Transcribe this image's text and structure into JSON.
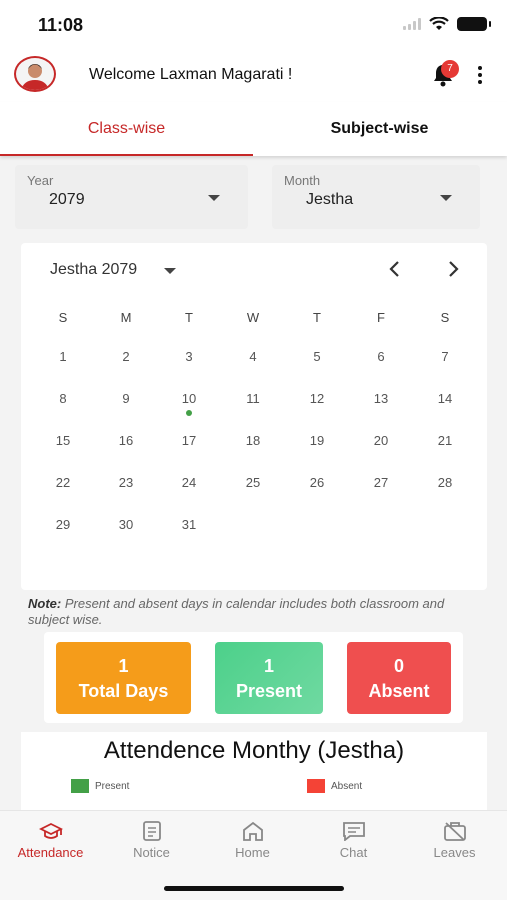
{
  "status_bar": {
    "time": "11:08"
  },
  "header": {
    "welcome_text": "Welcome Laxman Magarati !",
    "notification_count": "7"
  },
  "tabs": [
    {
      "label": "Class-wise",
      "active": true
    },
    {
      "label": "Subject-wise",
      "active": false
    }
  ],
  "filters": {
    "year": {
      "label": "Year",
      "value": "2079"
    },
    "month": {
      "label": "Month",
      "value": "Jestha"
    }
  },
  "calendar": {
    "title": "Jestha 2079",
    "weekdays": [
      "S",
      "M",
      "T",
      "W",
      "T",
      "F",
      "S"
    ],
    "days": [
      "1",
      "2",
      "3",
      "4",
      "5",
      "6",
      "7",
      "8",
      "9",
      "10",
      "11",
      "12",
      "13",
      "14",
      "15",
      "16",
      "17",
      "18",
      "19",
      "20",
      "21",
      "22",
      "23",
      "24",
      "25",
      "26",
      "27",
      "28",
      "29",
      "30",
      "31"
    ],
    "present_days": [
      "10"
    ],
    "present_color": "#43a047"
  },
  "note": {
    "label": "Note:",
    "text": "Present and absent days in calendar includes both classroom and subject wise."
  },
  "stats": {
    "total": {
      "value": "1",
      "label": "Total Days",
      "color": "#f59c1a"
    },
    "present": {
      "value": "1",
      "label": "Present",
      "color": "#4cd08a"
    },
    "absent": {
      "value": "0",
      "label": "Absent",
      "color": "#ef4f4f"
    }
  },
  "monthly": {
    "title": "Attendence Monthy (Jestha)",
    "legend": [
      {
        "label": "Present",
        "color": "#43a047"
      },
      {
        "label": "Absent",
        "color": "#f44336"
      }
    ]
  },
  "bottom_nav": [
    {
      "label": "Attendance",
      "icon": "graduation-cap-icon",
      "active": true
    },
    {
      "label": "Notice",
      "icon": "notice-icon",
      "active": false
    },
    {
      "label": "Home",
      "icon": "home-icon",
      "active": false
    },
    {
      "label": "Chat",
      "icon": "chat-icon",
      "active": false
    },
    {
      "label": "Leaves",
      "icon": "leave-briefcase-icon",
      "active": false
    }
  ],
  "colors": {
    "accent": "#c62828",
    "background": "#f3f3f3"
  }
}
